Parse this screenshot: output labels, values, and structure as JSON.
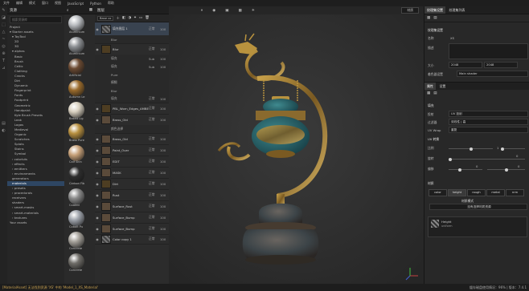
{
  "menubar": [
    "文件",
    "编辑",
    "模式",
    "窗口",
    "视图",
    "JavaScript",
    "Python",
    "帮助"
  ],
  "assets": {
    "title": "资源",
    "search_placeholder": "搜索资源库",
    "tree": [
      {
        "label": "Project",
        "indent": 1
      },
      {
        "label": "▾ Starter assets",
        "indent": 1
      },
      {
        "label": "▾ ToyTool",
        "indent": 2
      },
      {
        "label": "2D",
        "indent": 3
      },
      {
        "label": "3D",
        "indent": 3
      },
      {
        "label": "▾ alphas",
        "indent": 2
      },
      {
        "label": "Basic",
        "indent": 3
      },
      {
        "label": "Brush",
        "indent": 3
      },
      {
        "label": "Celtic",
        "indent": 3
      },
      {
        "label": "Clothing",
        "indent": 3
      },
      {
        "label": "Cracks",
        "indent": 3
      },
      {
        "label": "Dirt",
        "indent": 3
      },
      {
        "label": "Dynamic",
        "indent": 3
      },
      {
        "label": "Fingerprint",
        "indent": 3
      },
      {
        "label": "Fonts",
        "indent": 3
      },
      {
        "label": "Footprint",
        "indent": 3
      },
      {
        "label": "Geometric",
        "indent": 3
      },
      {
        "label": "Handpaint",
        "indent": 3
      },
      {
        "label": "Kyle Brush Presets",
        "indent": 3
      },
      {
        "label": "Leak",
        "indent": 3
      },
      {
        "label": "Logos",
        "indent": 3
      },
      {
        "label": "Medieval",
        "indent": 3
      },
      {
        "label": "Organic",
        "indent": 3
      },
      {
        "label": "Scratches",
        "indent": 3
      },
      {
        "label": "Splats",
        "indent": 3
      },
      {
        "label": "Stains",
        "indent": 3
      },
      {
        "label": "Symbol",
        "indent": 3
      },
      {
        "label": "› colorluts",
        "indent": 2
      },
      {
        "label": "› effects",
        "indent": 2
      },
      {
        "label": "› emitters",
        "indent": 2
      },
      {
        "label": "› environments",
        "indent": 2
      },
      {
        "label": "generators",
        "indent": 2
      },
      {
        "label": "materials",
        "indent": 2,
        "selected": true
      },
      {
        "label": "› presets",
        "indent": 2
      },
      {
        "label": "› procedurals",
        "indent": 2
      },
      {
        "label": "receivers",
        "indent": 2
      },
      {
        "label": "shaders",
        "indent": 2
      },
      {
        "label": "› smart-masks",
        "indent": 2
      },
      {
        "label": "› smart-materials",
        "indent": 2
      },
      {
        "label": "› textures",
        "indent": 2
      },
      {
        "label": "Your assets",
        "indent": 1
      }
    ]
  },
  "shelf": {
    "items": [
      {
        "label": "Aluminium",
        "color": "#b9bcc0"
      },
      {
        "label": "Aluminium",
        "color": "#8c8f93"
      },
      {
        "label": "Artificial",
        "color": "#6b4a32"
      },
      {
        "label": "Autumn Le",
        "color": "#9a6b2c"
      },
      {
        "label": "Baked Lig",
        "color": "#d8d0c0"
      },
      {
        "label": "Brass Pure",
        "color": "#b89040"
      },
      {
        "label": "Calf Skin",
        "color": "#c6a078"
      },
      {
        "label": "Carbon Fib",
        "color": "#2d2d2d"
      },
      {
        "label": "Coated",
        "color": "#8a8a8a"
      },
      {
        "label": "Cobalt Pu",
        "color": "#9ea3ab"
      },
      {
        "label": "Concrete",
        "color": "#a5a19a"
      },
      {
        "label": "Concrete",
        "color": "#6f6d68"
      }
    ]
  },
  "layers": {
    "title": "图层",
    "blend": "Base co",
    "rows": [
      {
        "name": "填充图层 1",
        "type": "fill",
        "blend": "正常",
        "opacity": "100"
      },
      {
        "name": "Blur",
        "type": "effect",
        "blend": "",
        "opacity": ""
      },
      {
        "name": "Blur",
        "type": "folder",
        "blend": "正常",
        "opacity": "100"
      },
      {
        "name": "填充",
        "type": "effect",
        "blend": "Sub",
        "opacity": "100"
      },
      {
        "name": "填充",
        "type": "effect",
        "blend": "Sub",
        "opacity": "100"
      },
      {
        "name": "Pure",
        "type": "effect",
        "blend": "",
        "opacity": ""
      },
      {
        "name": "模糊",
        "type": "effect",
        "blend": "",
        "opacity": ""
      },
      {
        "name": "Blur",
        "type": "effect",
        "blend": "",
        "opacity": ""
      },
      {
        "name": "填充",
        "type": "effect",
        "blend": "正常",
        "opacity": "100"
      },
      {
        "name": "PBL_Worn_Edges_AMBER",
        "type": "folder",
        "blend": "正常",
        "opacity": "100"
      },
      {
        "name": "Brass_Old",
        "type": "layer",
        "blend": "正常",
        "opacity": "100"
      },
      {
        "name": "颜色选择",
        "type": "effect",
        "blend": "",
        "opacity": ""
      },
      {
        "name": "Brass_Old",
        "type": "layer",
        "blend": "正常",
        "opacity": "100"
      },
      {
        "name": "Paint_Over",
        "type": "layer",
        "blend": "正常",
        "opacity": "100"
      },
      {
        "name": "EDIT",
        "type": "layer",
        "blend": "正常",
        "opacity": "100"
      },
      {
        "name": "MASK",
        "type": "layer",
        "blend": "正常",
        "opacity": "100"
      },
      {
        "name": "Dirt",
        "type": "folder",
        "blend": "正常",
        "opacity": "100"
      },
      {
        "name": "Rust",
        "type": "layer",
        "blend": "正常",
        "opacity": "100"
      },
      {
        "name": "Surface_Rust",
        "type": "layer",
        "blend": "正常",
        "opacity": "100"
      },
      {
        "name": "Surface_Bump",
        "type": "layer",
        "blend": "正常",
        "opacity": "100"
      },
      {
        "name": "Surface_Bump",
        "type": "layer",
        "blend": "正常",
        "opacity": "100"
      },
      {
        "name": "Color copy 1",
        "type": "fill",
        "blend": "正常",
        "opacity": "100"
      }
    ]
  },
  "viewport": {
    "mode": "材质",
    "axis": [
      "X",
      "Y",
      "Z"
    ]
  },
  "right": {
    "tabs": [
      "纹理集设置",
      "纹理集列表"
    ],
    "texset": {
      "title": "纹理集设置",
      "name_label": "名称",
      "name_value": "XS",
      "desc_label": "描述",
      "size_label": "大小",
      "size_value": "2048",
      "size_value2": "2048",
      "normal_label": "着色器设置",
      "normal_value": "Main shader"
    },
    "props": {
      "tabs": [
        "属性",
        "设置"
      ],
      "section": "填充",
      "proj_label": "投射",
      "proj_value": "UV 投射",
      "filter_label": "过滤器",
      "filter_value": "双线性 | 高",
      "uv_label": "UV Wrap",
      "uv_value": "重复",
      "uvt_label": "UV 转换",
      "scale_label": "比例",
      "scale_value": "1",
      "rotate_label": "旋转",
      "rotate_value": "0",
      "offset_label": "偏移",
      "offset_x": "0",
      "offset_y": "0",
      "channels_label": "材质",
      "channels": [
        "color",
        "height",
        "rough",
        "metal",
        "nrm"
      ],
      "mode_label": "材质模式",
      "mode_value": "没有选择材质资源",
      "res_name": "Height",
      "res_sub": "uniform"
    }
  },
  "status": {
    "left": "[MaterialAsset] 无法找到资源 'XS' 中的 'Model_1_XS_Material'",
    "right": "缓存磁盘使用情况：96%  | 版本：7.4.1"
  },
  "colors": {
    "accent": "#2e4663",
    "bg": "#2b2b2b"
  }
}
